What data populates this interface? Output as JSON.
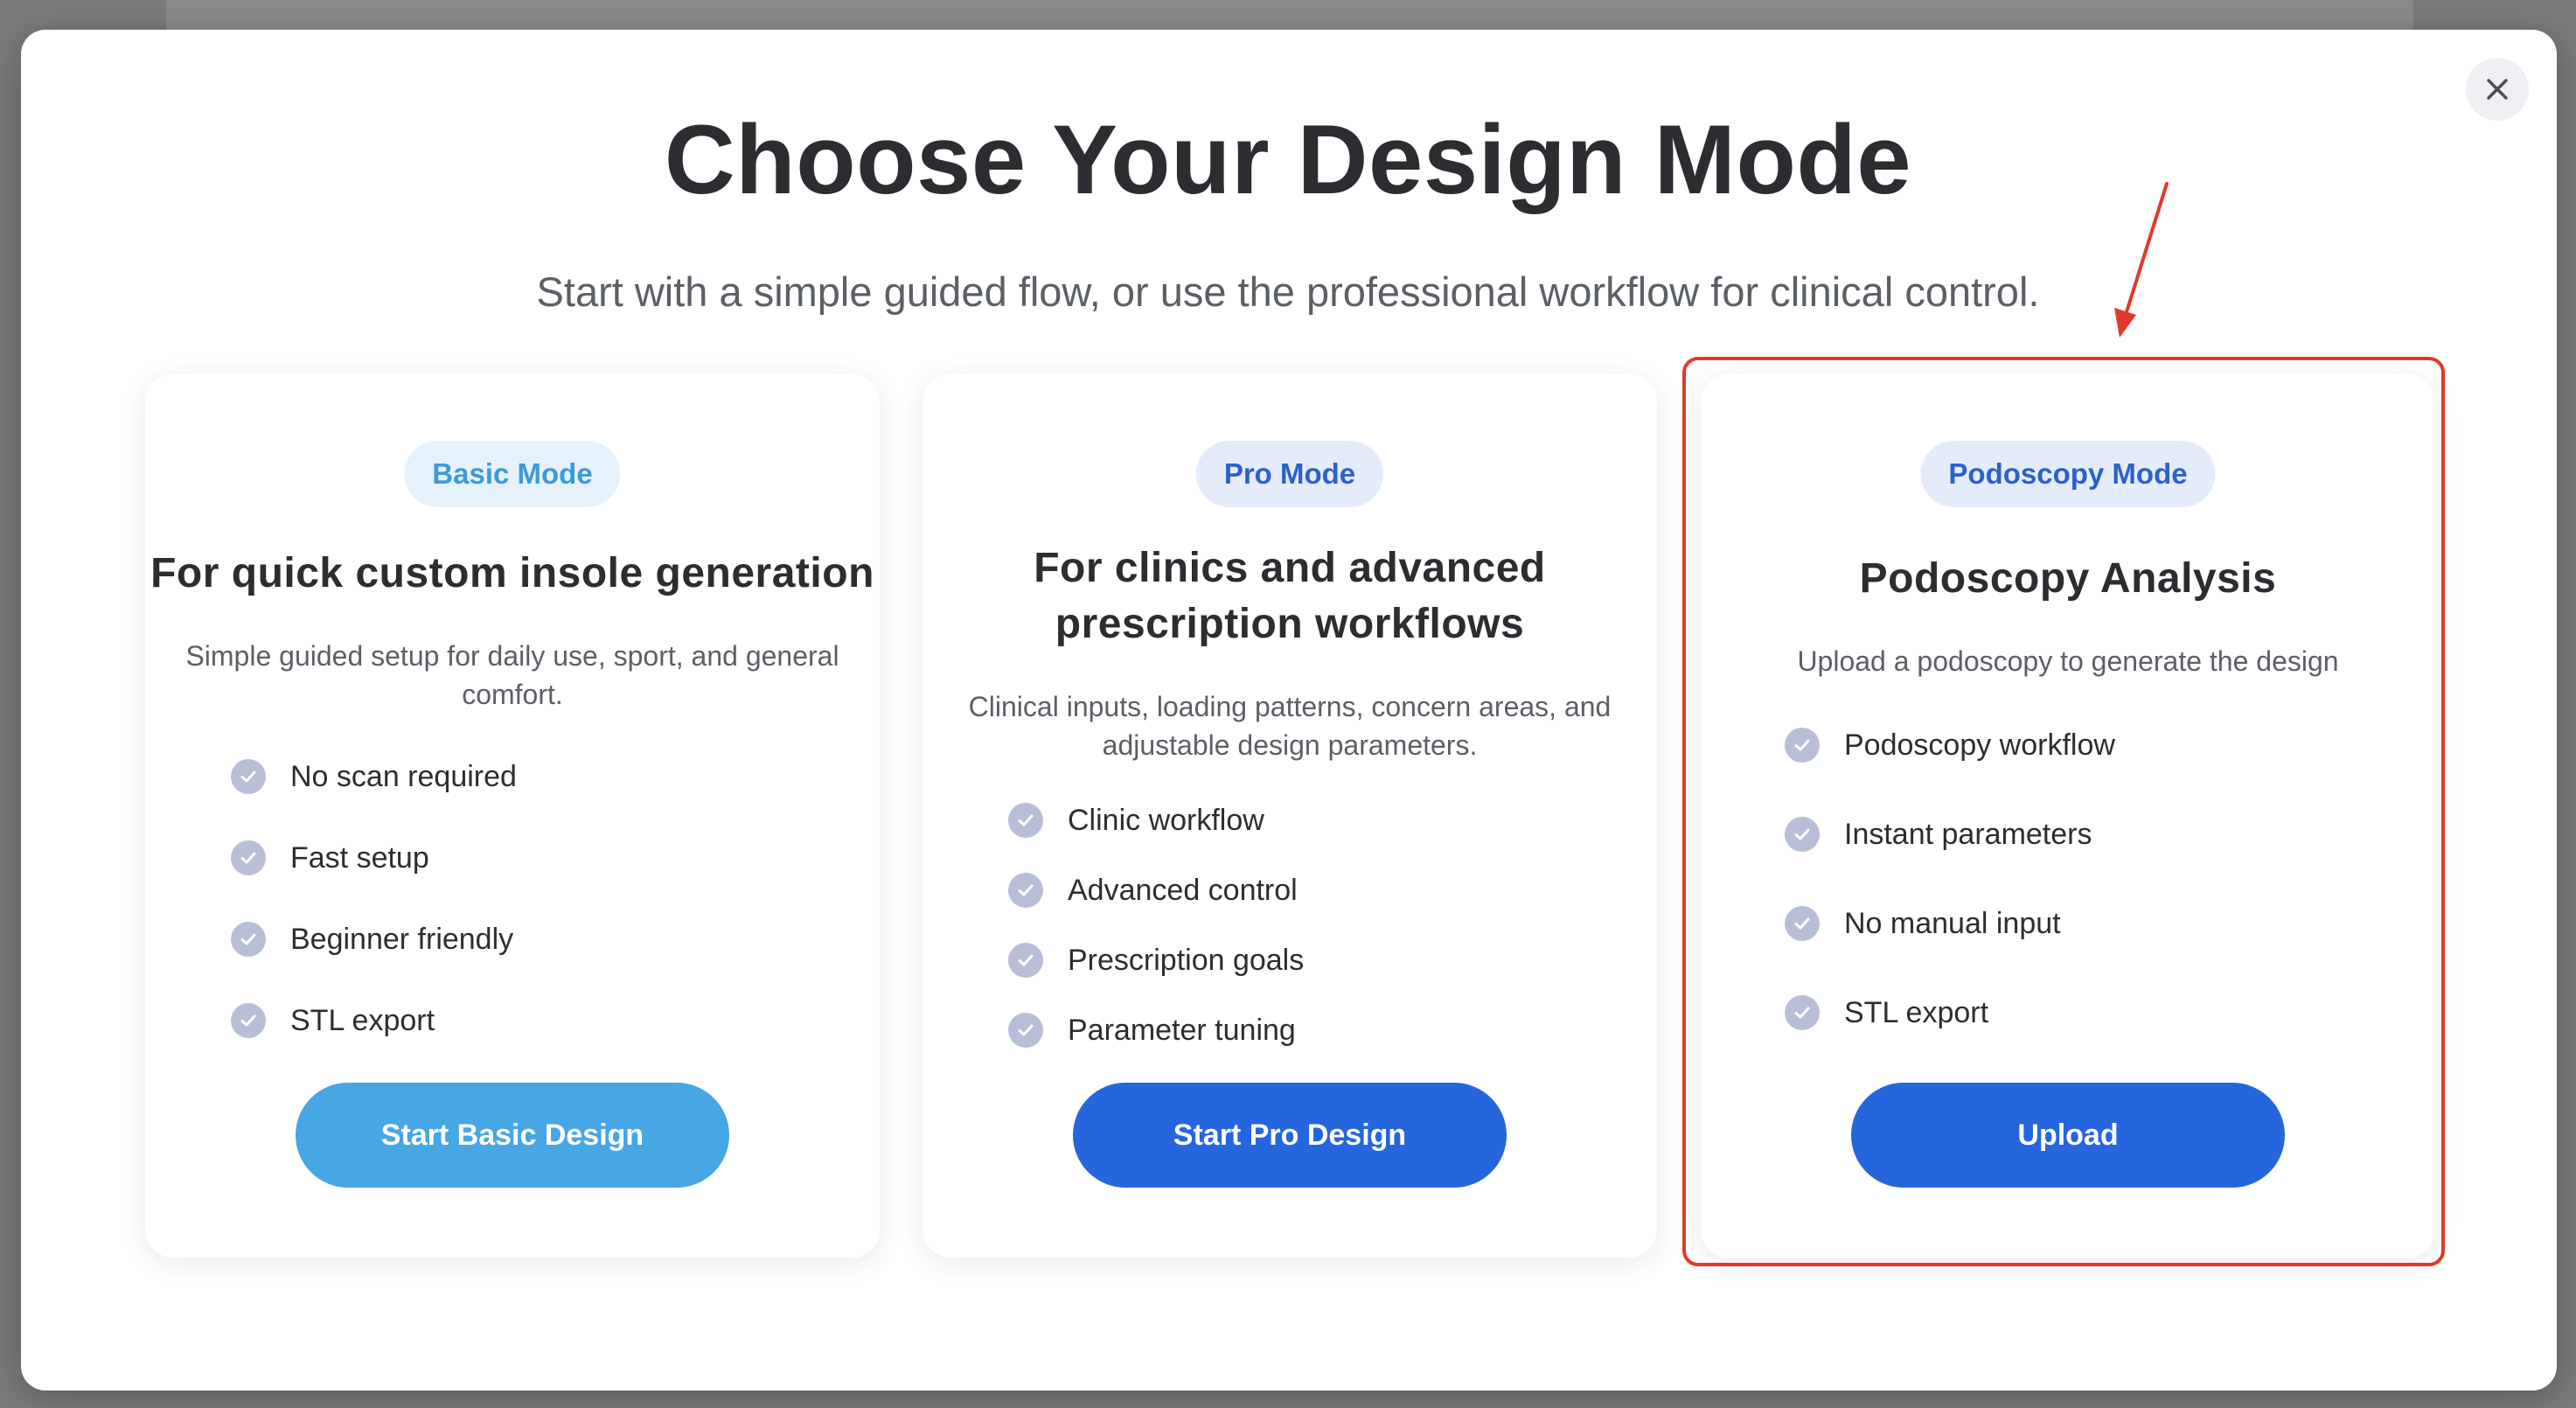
{
  "modal": {
    "title": "Choose Your Design Mode",
    "subtitle": "Start with a simple guided flow, or use the professional workflow for clinical control.",
    "close_icon": "close-icon"
  },
  "cards": [
    {
      "badge": "Basic Mode",
      "heading": "For quick custom insole generation",
      "description": "Simple guided setup for daily use, sport, and general comfort.",
      "features": [
        "No scan required",
        "Fast setup",
        "Beginner friendly",
        "STL export"
      ],
      "button": "Start Basic Design"
    },
    {
      "badge": "Pro Mode",
      "heading": "For clinics and advanced prescription workflows",
      "description": "Clinical inputs, loading patterns, concern areas, and adjustable design parameters.",
      "features": [
        "Clinic workflow",
        "Advanced control",
        "Prescription goals",
        "Parameter tuning"
      ],
      "button": "Start Pro Design"
    },
    {
      "badge": "Podoscopy Mode",
      "heading": "Podoscopy Analysis",
      "description": "Upload a podoscopy to generate the design",
      "features": [
        "Podoscopy workflow",
        "Instant parameters",
        "No manual input",
        "STL export"
      ],
      "button": "Upload"
    }
  ],
  "colors": {
    "light_blue": "#47a6e4",
    "dark_blue": "#2566de",
    "highlight_red": "#e0392b",
    "check_icon": "#b9bed8"
  },
  "icons": [
    "close-icon",
    "check-circle-icon",
    "annotation-arrow"
  ]
}
